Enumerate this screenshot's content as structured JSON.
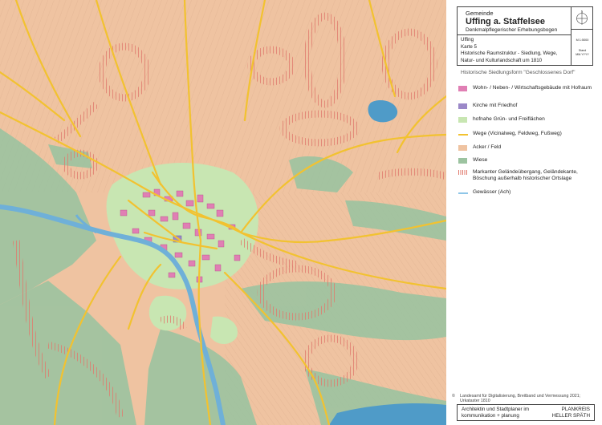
{
  "title_block": {
    "municipality_label": "Gemeinde",
    "town_name": "Uffing a. Staffelsee",
    "form_name": "Denkmalpflegerischer Erhebungsbogen",
    "place": "Uffing",
    "map_number": "Karte 5",
    "map_title": "Historische Raumstruktur - Siedlung, Wege, Natur- und Kulturlandschaft um 1810",
    "scale": "M 1:5000",
    "date_line1": "Stand",
    "date_line2": "MM.YYYY",
    "north_icon": "north-arrow-icon"
  },
  "legend": {
    "heading": "Historische Siedlungsform \"Geschlossenes Dorf\"",
    "items": [
      {
        "label": "Wohn- / Neben- / Wirtschaftsgebäude mit Hofraum",
        "color": "#e07fb4"
      },
      {
        "label": "Kirche mit Friedhof",
        "color": "#9b88c8"
      },
      {
        "label": "hofnahe Grün- und Freiflächen",
        "color": "#c8e6b2"
      },
      {
        "label": "Wege (Vicinalweg, Feldweg, Fußweg)",
        "color": "#f2c230"
      },
      {
        "label": "Acker / Feld",
        "color": "#efc3a1"
      },
      {
        "label": "Wiese",
        "color": "#9cc3a0"
      },
      {
        "label": "Markanter Geländeübergang, Geländekante, Böschung außerhalb historischer Ortslage",
        "color": "#e07a6d"
      },
      {
        "label": "Gewässer (Ach)",
        "color": "#8ec6e8"
      }
    ]
  },
  "credit": {
    "icon": "copyright-icon",
    "text": "Landesamt für Digitalisierung, Breitband und Vermessung 2021; Urkataster 1810"
  },
  "footer": {
    "left_line1": "Architektin und Stadtplaner im",
    "left_line2": "kommunikation + planung",
    "right_line1": "PLANKREIS",
    "right_line2": "HELLER SPÄTH"
  }
}
